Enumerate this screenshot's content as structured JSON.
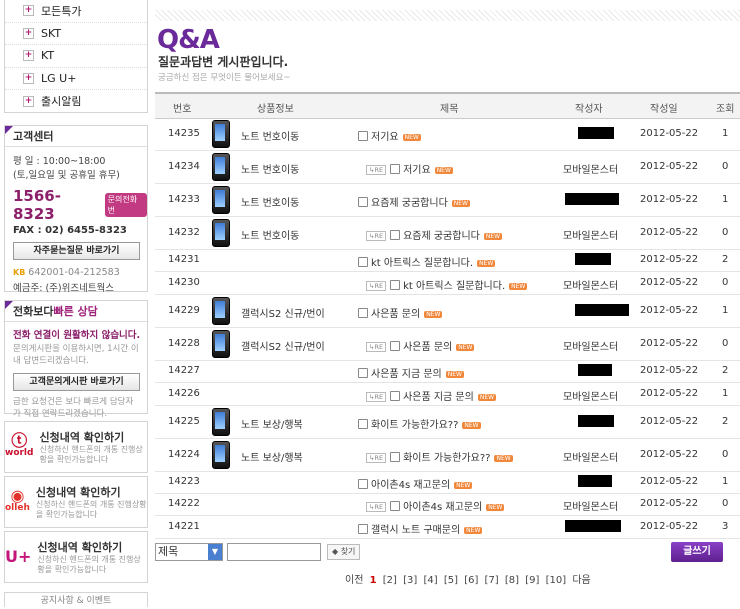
{
  "left_menu": [
    {
      "label": "모든특가"
    },
    {
      "label": "SKT"
    },
    {
      "label": "KT"
    },
    {
      "label": "LG U+"
    },
    {
      "label": "출시알림"
    }
  ],
  "customer_center": {
    "title": "고객센터",
    "hours": "평     일 : 10:00~18:00",
    "holiday": "(토,일요일 및 공휴일 휴무)",
    "phone": "1566-8323",
    "phone_badge": "문의전화번",
    "fax": "FAX : 02) 6455-8323",
    "faq_button": "자주묻는질문 바로가기",
    "bank_logo": "KB",
    "account": "642001-04-212583",
    "depositor": "예금주: (주)위즈네트웍스"
  },
  "quick_consult": {
    "title_a": "전화보다 ",
    "title_b": "빠른 상담",
    "line1": "전화 연결이 원활하지 않습니다.",
    "line2": "문의게시판을 이용하시면, 1시간 이내 답변드리겠습니다.",
    "button": "고객문의게시판 바로가기",
    "line3": "급한 요청건은 보다 빠르게 담당자가 직접 연락드리겠습니다."
  },
  "registrations": [
    {
      "logo": "world",
      "logo_color": "#c8102e",
      "title": "신청내역 확인하기",
      "sub": "신청하신 핸드폰의 개통 진행상황을 확인가능합니다"
    },
    {
      "logo": "olleh",
      "logo_color": "#e3322b",
      "title": "신청내역 확인하기",
      "sub": "신청하신 핸드폰의 개통 진행상황을 확인가능합니다"
    },
    {
      "logo": "U+",
      "logo_color": "#c4157b",
      "title": "신청내역 확인하기",
      "sub": "신청하신 핸드폰의 개통 진행상황을 확인가능합니다"
    }
  ],
  "bottom_partial": "공지사항 & 이벤트",
  "header": {
    "title": "Q&A",
    "subtitle": "질문과답변 게시판입니다.",
    "hint": "궁금하신 점은 무엇이든 물어보세요~"
  },
  "columns": [
    "번호",
    "상품정보",
    "제목",
    "작성자",
    "작성일",
    "조회"
  ],
  "rows": [
    {
      "no": "14235",
      "product": "노트 번호이동",
      "title": "저기요",
      "reply": false,
      "author": "",
      "date": "2012-05-22",
      "views": "1"
    },
    {
      "no": "14234",
      "product": "노트 번호이동",
      "title": "저기요",
      "reply": true,
      "author": "모바일몬스터",
      "date": "2012-05-22",
      "views": "0"
    },
    {
      "no": "14233",
      "product": "노트 번호이동",
      "title": "요즘제 궁굼합니다",
      "reply": false,
      "author": "",
      "date": "2012-05-22",
      "views": "1"
    },
    {
      "no": "14232",
      "product": "노트 번호이동",
      "title": "요즘제 궁굼합니다",
      "reply": true,
      "author": "모바일몬스터",
      "date": "2012-05-22",
      "views": "0"
    },
    {
      "no": "14231",
      "product": "",
      "title": "kt 아트릭스 질문합니다.",
      "reply": false,
      "author": "",
      "date": "2012-05-22",
      "views": "2"
    },
    {
      "no": "14230",
      "product": "",
      "title": "kt 아트릭스 질문합니다.",
      "reply": true,
      "author": "모바일몬스터",
      "date": "2012-05-22",
      "views": "0"
    },
    {
      "no": "14229",
      "product": "갤럭시S2 신규/번이",
      "title": "사은품 문의",
      "reply": false,
      "author": "",
      "date": "2012-05-22",
      "views": "1"
    },
    {
      "no": "14228",
      "product": "갤럭시S2 신규/번이",
      "title": "사은품 문의",
      "reply": true,
      "author": "모바일몬스터",
      "date": "2012-05-22",
      "views": "0"
    },
    {
      "no": "14227",
      "product": "",
      "title": "사은품 지금 문의",
      "reply": false,
      "author": "",
      "date": "2012-05-22",
      "views": "2"
    },
    {
      "no": "14226",
      "product": "",
      "title": "사은품 지금 문의",
      "reply": true,
      "author": "모바일몬스터",
      "date": "2012-05-22",
      "views": "1"
    },
    {
      "no": "14225",
      "product": "노트 보상/행복",
      "title": "화이트 가능한가요??",
      "reply": false,
      "author": "",
      "date": "2012-05-22",
      "views": "2"
    },
    {
      "no": "14224",
      "product": "노트 보상/행복",
      "title": "화이트 가능한가요??",
      "reply": true,
      "author": "모바일몬스터",
      "date": "2012-05-22",
      "views": "0"
    },
    {
      "no": "14223",
      "product": "",
      "title": "아이촌4s 재고문의",
      "reply": false,
      "author": "",
      "date": "2012-05-22",
      "views": "1"
    },
    {
      "no": "14222",
      "product": "",
      "title": "아이촌4s 재고문의",
      "reply": true,
      "author": "모바일몬스터",
      "date": "2012-05-22",
      "views": "0"
    },
    {
      "no": "14221",
      "product": "",
      "title": "갤럭시 노트 구매문의",
      "reply": false,
      "author": "",
      "date": "2012-05-22",
      "views": "3"
    }
  ],
  "search": {
    "field": "제목",
    "find_button": "◆ 찾기",
    "write_button": "글쓰기"
  },
  "pager": {
    "prev": "이전",
    "pages": [
      "1",
      "[2]",
      "[3]",
      "[4]",
      "[5]",
      "[6]",
      "[7]",
      "[8]",
      "[9]",
      "[10]"
    ],
    "next": "다음",
    "current": "1"
  }
}
